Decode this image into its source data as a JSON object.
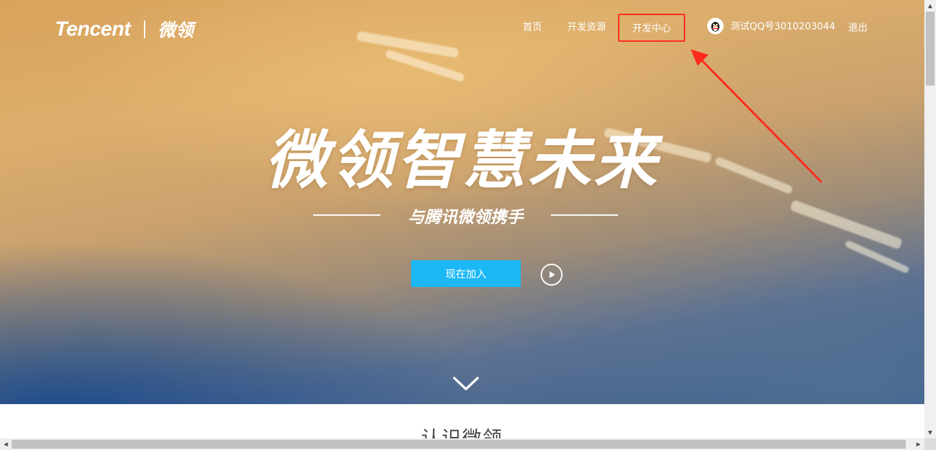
{
  "header": {
    "brand": "Tencent",
    "product": "微领",
    "nav": {
      "home": "首页",
      "resources": "开发资源",
      "dev_center": "开发中心"
    },
    "user": {
      "name": "测试QQ号3010203044",
      "avatar_icon": "qq-penguin-icon"
    },
    "logout": "退出"
  },
  "hero": {
    "headline": "微领智慧未来",
    "tagline": "与腾讯微领携手",
    "join_button": "现在加入",
    "play_icon": "play-circle-icon",
    "scroll_icon": "chevron-down-icon"
  },
  "section": {
    "title": "认识微领"
  },
  "annotation": {
    "highlight_color": "#ff2a1a",
    "arrow_icon": "red-arrow-icon"
  },
  "colors": {
    "accent": "#1bb8f5",
    "hero_warm": "#d9a35c",
    "hero_cool": "#3b5f8e"
  }
}
